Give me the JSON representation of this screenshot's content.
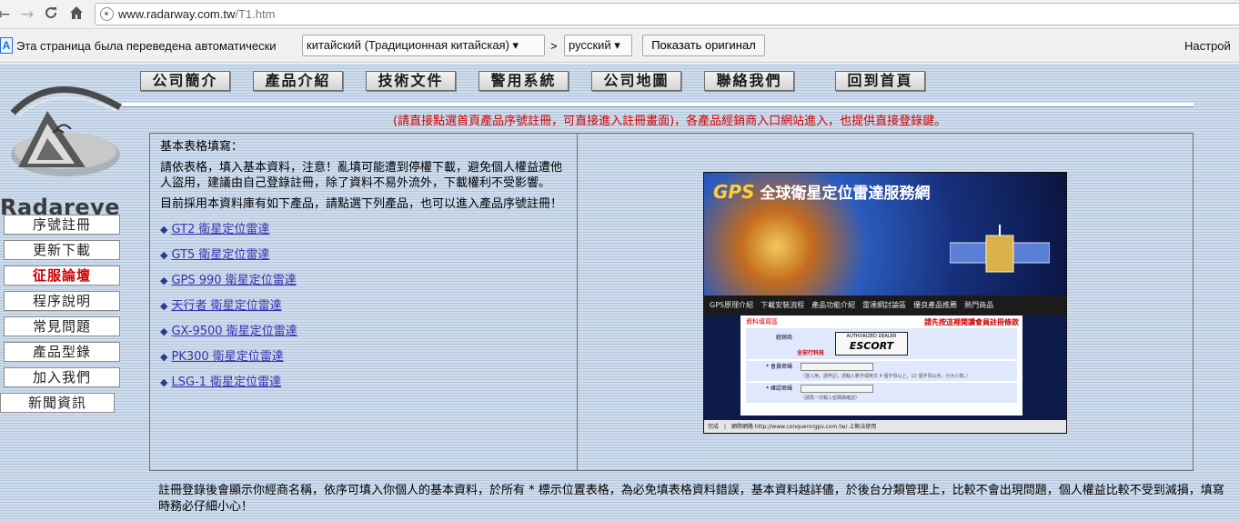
{
  "browser": {
    "url_host": "www.radarway.com.tw",
    "url_path": "/T1.htm"
  },
  "translate_bar": {
    "message": "Эта страница была переведена автоматически",
    "from_language": "китайский (Традиционная китайская) ▾",
    "separator": ">",
    "to_language": "русский ▾",
    "show_original_label": "Показать оригинал",
    "settings_label": "Настрой"
  },
  "top_nav": [
    {
      "label": "公司簡介"
    },
    {
      "label": "產品介紹"
    },
    {
      "label": "技術文件"
    },
    {
      "label": "警用系統"
    },
    {
      "label": "公司地圖"
    },
    {
      "label": "聯絡我們"
    },
    {
      "label": "回到首頁"
    }
  ],
  "logo": {
    "text": "Radareye"
  },
  "sidebar": [
    {
      "label": "序號註冊",
      "active": false
    },
    {
      "label": "更新下載",
      "active": false
    },
    {
      "label": "征服論壇",
      "active": true
    },
    {
      "label": "程序說明",
      "active": false
    },
    {
      "label": "常見問題",
      "active": false
    },
    {
      "label": "產品型錄",
      "active": false
    },
    {
      "label": "加入我們",
      "active": false
    },
    {
      "label": "新聞資訊",
      "active": false
    }
  ],
  "notice": "(請直接點選首頁產品序號註冊，可直接進入註冊畫面)，各產品經銷商入口網站進入，也提供直接登錄鍵。",
  "content": {
    "heading": "基本表格填寫：",
    "paragraph1": "請依表格，填入基本資料，注意！亂填可能遭到停權下載，避免個人權益遭他人盜用，建議由自己登錄註冊，除了資料不易外流外，下載權利不受影響。",
    "paragraph2": "目前採用本資料庫有如下產品，請點選下列產品，也可以進入產品序號註冊！",
    "bullet": "◆",
    "products": [
      {
        "label": "GT2 衛星定位雷達"
      },
      {
        "label": "GT5 衛星定位雷達"
      },
      {
        "label": "GPS 990 衛星定位雷達"
      },
      {
        "label": "天行者 衛星定位雷達"
      },
      {
        "label": "GX-9500 衛星定位雷達"
      },
      {
        "label": "PK300 衛星定位雷達"
      },
      {
        "label": "LSG-1 衛星定位雷達"
      }
    ]
  },
  "gps_screenshot": {
    "title_brand": "GPS",
    "title": "全球衛星定位雷達服務網",
    "tabs": "GPS原理介紹　下載安裝流程　產品功能介紹　雷達網討論區　優良產品推薦　熱門商品",
    "form_title": "資料填寫區",
    "form_note": "請先按這裡閱讀會員註冊條款",
    "dealer_label": "經銷商",
    "dealer_name": "全安行科技",
    "escort_small": "AUTHORIZED DEALER",
    "escort_big": "ESCORT",
    "password_label": "* 會員密碼",
    "password_hint": "（登入用，請牢記，請輸入數字或英文 4 個字母以上，12 個字母以內，分大小寫。）",
    "confirm_label": "* 確認密碼",
    "confirm_hint": "（請再一次輸入密碼做確認）",
    "status": "完成　|　網際網路 http://www.conquerorgps.com.tw/ 上無法使用"
  },
  "footer_note": "註冊登錄後會顯示你經商名稱，依序可填入你個人的基本資料，於所有 * 標示位置表格，為必免填表格資料錯誤，基本資料越詳儘，於後台分類管理上，比較不會出現問題，個人權益比較不受到減損，填寫時務必仔細小心！"
}
